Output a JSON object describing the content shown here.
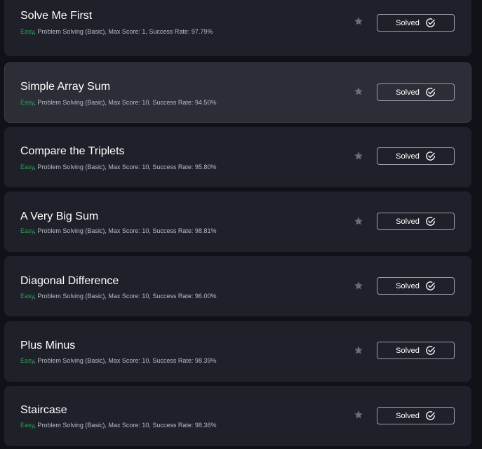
{
  "challenges": [
    {
      "title": "Solve Me First",
      "difficulty": "Easy",
      "meta": ", Problem Solving (Basic), Max Score: 1, Success Rate: 97.79%",
      "status": "Solved"
    },
    {
      "title": "Simple Array Sum",
      "difficulty": "Easy",
      "meta": ", Problem Solving (Basic), Max Score: 10, Success Rate: 94.50%",
      "status": "Solved"
    },
    {
      "title": "Compare the Triplets",
      "difficulty": "Easy",
      "meta": ", Problem Solving (Basic), Max Score: 10, Success Rate: 95.80%",
      "status": "Solved"
    },
    {
      "title": "A Very Big Sum",
      "difficulty": "Easy",
      "meta": ", Problem Solving (Basic), Max Score: 10, Success Rate: 98.81%",
      "status": "Solved"
    },
    {
      "title": "Diagonal Difference",
      "difficulty": "Easy",
      "meta": ", Problem Solving (Basic), Max Score: 10, Success Rate: 96.00%",
      "status": "Solved"
    },
    {
      "title": "Plus Minus",
      "difficulty": "Easy",
      "meta": ", Problem Solving (Basic), Max Score: 10, Success Rate: 98.39%",
      "status": "Solved"
    },
    {
      "title": "Staircase",
      "difficulty": "Easy",
      "meta": ", Problem Solving (Basic), Max Score: 10, Success Rate: 98.36%",
      "status": "Solved"
    }
  ],
  "colors": {
    "difficulty_easy": "#1ba94c",
    "card_bg": "#1f2029",
    "card_hover_bg": "#2c2d36",
    "star": "#6b6e78"
  },
  "icons": {
    "bookmark": "star-icon",
    "solved": "check-circle-icon"
  }
}
